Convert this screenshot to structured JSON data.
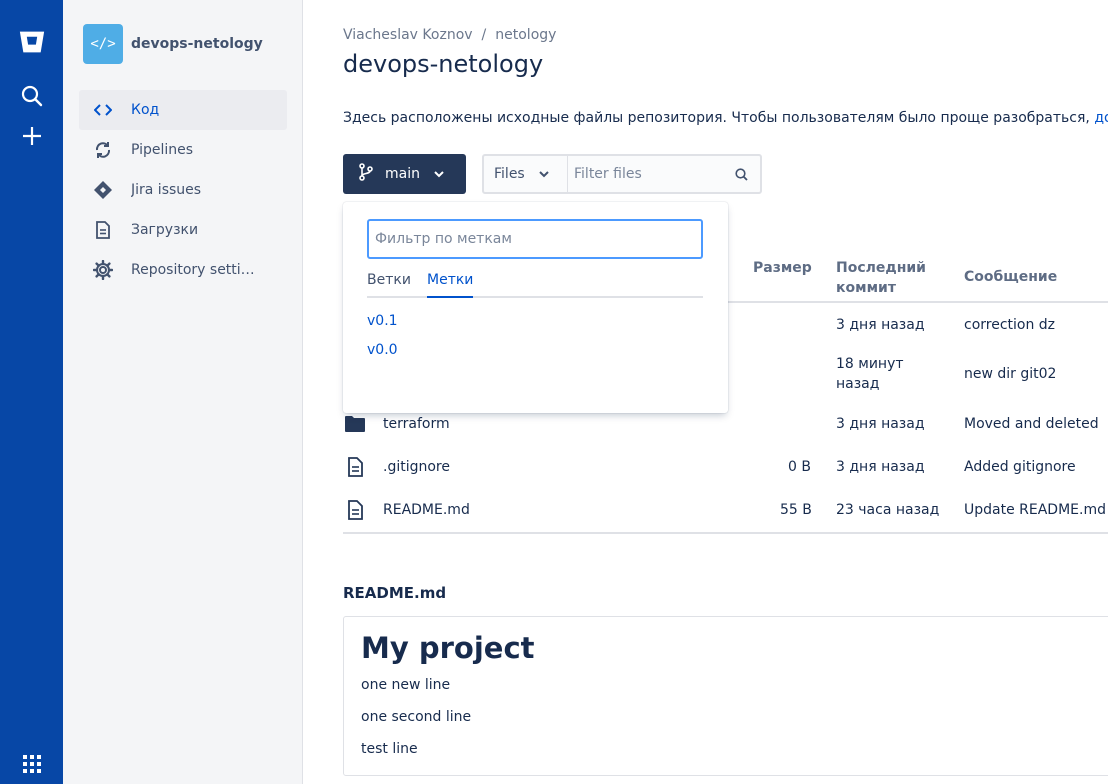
{
  "global_nav": {
    "icons": [
      "bitbucket-logo",
      "search-icon",
      "plus-icon",
      "app-switcher-icon"
    ]
  },
  "sidebar": {
    "project": {
      "avatar": "</>",
      "name": "devops-netology"
    },
    "items": [
      {
        "label": "Код",
        "icon": "code-icon",
        "active": true
      },
      {
        "label": "Pipelines",
        "icon": "pipelines-icon",
        "active": false
      },
      {
        "label": "Jira issues",
        "icon": "jira-icon",
        "active": false
      },
      {
        "label": "Загрузки",
        "icon": "file-icon",
        "active": false
      },
      {
        "label": "Repository setti…",
        "icon": "gear-icon",
        "active": false
      }
    ]
  },
  "breadcrumb": {
    "owner": "Viacheslav Koznov",
    "separator": "/",
    "project": "netology"
  },
  "page_title": "devops-netology",
  "description": {
    "text": "Здесь расположены исходные файлы репозитория. Чтобы пользователям было проще разобраться, ",
    "link": "до"
  },
  "branch_button": {
    "label": "main"
  },
  "files_filter": {
    "select_label": "Files",
    "placeholder": "Filter files"
  },
  "table": {
    "headers": {
      "size": "Размер",
      "last_commit": "Последний коммит",
      "message": "Сообщение"
    },
    "rows": [
      {
        "icon": "folder-icon",
        "name": "",
        "size": "",
        "last_commit": "3 дня назад",
        "message": "correction dz"
      },
      {
        "icon": "folder-icon",
        "name": "",
        "size": "",
        "last_commit": "18 минут назад",
        "message": "new dir git02"
      },
      {
        "icon": "folder-icon",
        "name": "terraform",
        "size": "",
        "last_commit": "3 дня назад",
        "message": "Moved and deleted"
      },
      {
        "icon": "file-icon",
        "name": ".gitignore",
        "size": "0 B",
        "last_commit": "3 дня назад",
        "message": "Added gitignore"
      },
      {
        "icon": "file-icon",
        "name": "README.md",
        "size": "55 B",
        "last_commit": "23 часа назад",
        "message": "Update README.md"
      }
    ]
  },
  "readme": {
    "title": "README.md",
    "heading": "My project",
    "lines": [
      "one new line",
      "one second line",
      "test line"
    ]
  },
  "dropdown": {
    "placeholder": "Фильтр по меткам",
    "tabs": [
      {
        "label": "Ветки",
        "active": false
      },
      {
        "label": "Метки",
        "active": true
      }
    ],
    "items": [
      "v0.1",
      "v0.0"
    ]
  },
  "colors": {
    "global_nav": "#0747a6",
    "accent": "#0052cc",
    "branch_button": "#253858",
    "project_avatar": "#4fade6"
  }
}
